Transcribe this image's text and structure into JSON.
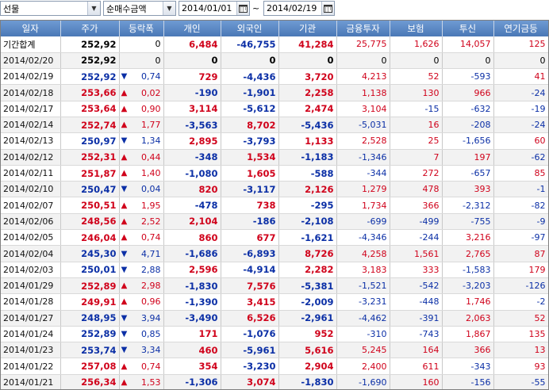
{
  "toolbar": {
    "market_select": "선물",
    "type_select": "순매수금액",
    "date_from": "2014/01/01",
    "date_sep": "~",
    "date_to": "2014/02/19"
  },
  "columns": [
    "일자",
    "주가",
    "등락폭",
    "개인",
    "외국인",
    "기관",
    "금융투자",
    "보험",
    "투신",
    "연기금등"
  ],
  "colors": {
    "up": "#d0021b",
    "down": "#0b2fa6",
    "header": "#4f81bd"
  },
  "summary": {
    "label": "기간합계",
    "price": "252,92",
    "change": "0",
    "individual": "6,484",
    "foreign": "-46,755",
    "institution": "41,284",
    "fin_invest": "25,775",
    "insurance": "1,626",
    "trust": "14,057",
    "pension": "125"
  },
  "rows": [
    {
      "date": "2014/02/20",
      "price": "252,92",
      "dir": "",
      "change": "0",
      "individual": "0",
      "foreign": "0",
      "institution": "0",
      "fin_invest": "0",
      "insurance": "0",
      "trust": "0",
      "pension": "0"
    },
    {
      "date": "2014/02/19",
      "price": "252,92",
      "dir": "down",
      "change": "0,74",
      "individual": "729",
      "foreign": "-4,436",
      "institution": "3,720",
      "fin_invest": "4,213",
      "insurance": "52",
      "trust": "-593",
      "pension": "41"
    },
    {
      "date": "2014/02/18",
      "price": "253,66",
      "dir": "up",
      "change": "0,02",
      "individual": "-190",
      "foreign": "-1,901",
      "institution": "2,258",
      "fin_invest": "1,138",
      "insurance": "130",
      "trust": "966",
      "pension": "-24"
    },
    {
      "date": "2014/02/17",
      "price": "253,64",
      "dir": "up",
      "change": "0,90",
      "individual": "3,114",
      "foreign": "-5,612",
      "institution": "2,474",
      "fin_invest": "3,104",
      "insurance": "-15",
      "trust": "-632",
      "pension": "-19"
    },
    {
      "date": "2014/02/14",
      "price": "252,74",
      "dir": "up",
      "change": "1,77",
      "individual": "-3,563",
      "foreign": "8,702",
      "institution": "-5,436",
      "fin_invest": "-5,031",
      "insurance": "16",
      "trust": "-208",
      "pension": "-24"
    },
    {
      "date": "2014/02/13",
      "price": "250,97",
      "dir": "down",
      "change": "1,34",
      "individual": "2,895",
      "foreign": "-3,793",
      "institution": "1,133",
      "fin_invest": "2,528",
      "insurance": "25",
      "trust": "-1,656",
      "pension": "60"
    },
    {
      "date": "2014/02/12",
      "price": "252,31",
      "dir": "up",
      "change": "0,44",
      "individual": "-348",
      "foreign": "1,534",
      "institution": "-1,183",
      "fin_invest": "-1,346",
      "insurance": "7",
      "trust": "197",
      "pension": "-62"
    },
    {
      "date": "2014/02/11",
      "price": "251,87",
      "dir": "up",
      "change": "1,40",
      "individual": "-1,080",
      "foreign": "1,605",
      "institution": "-588",
      "fin_invest": "-344",
      "insurance": "272",
      "trust": "-657",
      "pension": "85"
    },
    {
      "date": "2014/02/10",
      "price": "250,47",
      "dir": "down",
      "change": "0,04",
      "individual": "820",
      "foreign": "-3,117",
      "institution": "2,126",
      "fin_invest": "1,279",
      "insurance": "478",
      "trust": "393",
      "pension": "-1"
    },
    {
      "date": "2014/02/07",
      "price": "250,51",
      "dir": "up",
      "change": "1,95",
      "individual": "-478",
      "foreign": "738",
      "institution": "-295",
      "fin_invest": "1,734",
      "insurance": "366",
      "trust": "-2,312",
      "pension": "-82"
    },
    {
      "date": "2014/02/06",
      "price": "248,56",
      "dir": "up",
      "change": "2,52",
      "individual": "2,104",
      "foreign": "-186",
      "institution": "-2,108",
      "fin_invest": "-699",
      "insurance": "-499",
      "trust": "-755",
      "pension": "-9"
    },
    {
      "date": "2014/02/05",
      "price": "246,04",
      "dir": "up",
      "change": "0,74",
      "individual": "860",
      "foreign": "677",
      "institution": "-1,621",
      "fin_invest": "-4,346",
      "insurance": "-244",
      "trust": "3,216",
      "pension": "-97"
    },
    {
      "date": "2014/02/04",
      "price": "245,30",
      "dir": "down",
      "change": "4,71",
      "individual": "-1,686",
      "foreign": "-6,893",
      "institution": "8,726",
      "fin_invest": "4,258",
      "insurance": "1,561",
      "trust": "2,765",
      "pension": "87"
    },
    {
      "date": "2014/02/03",
      "price": "250,01",
      "dir": "down",
      "change": "2,88",
      "individual": "2,596",
      "foreign": "-4,914",
      "institution": "2,282",
      "fin_invest": "3,183",
      "insurance": "333",
      "trust": "-1,583",
      "pension": "179"
    },
    {
      "date": "2014/01/29",
      "price": "252,89",
      "dir": "up",
      "change": "2,98",
      "individual": "-1,830",
      "foreign": "7,576",
      "institution": "-5,381",
      "fin_invest": "-1,521",
      "insurance": "-542",
      "trust": "-3,203",
      "pension": "-126"
    },
    {
      "date": "2014/01/28",
      "price": "249,91",
      "dir": "up",
      "change": "0,96",
      "individual": "-1,390",
      "foreign": "3,415",
      "institution": "-2,009",
      "fin_invest": "-3,231",
      "insurance": "-448",
      "trust": "1,746",
      "pension": "-2"
    },
    {
      "date": "2014/01/27",
      "price": "248,95",
      "dir": "down",
      "change": "3,94",
      "individual": "-3,490",
      "foreign": "6,526",
      "institution": "-2,961",
      "fin_invest": "-4,462",
      "insurance": "-391",
      "trust": "2,063",
      "pension": "52"
    },
    {
      "date": "2014/01/24",
      "price": "252,89",
      "dir": "down",
      "change": "0,85",
      "individual": "171",
      "foreign": "-1,076",
      "institution": "952",
      "fin_invest": "-310",
      "insurance": "-743",
      "trust": "1,867",
      "pension": "135"
    },
    {
      "date": "2014/01/23",
      "price": "253,74",
      "dir": "down",
      "change": "3,34",
      "individual": "460",
      "foreign": "-5,961",
      "institution": "5,616",
      "fin_invest": "5,245",
      "insurance": "164",
      "trust": "366",
      "pension": "13"
    },
    {
      "date": "2014/01/22",
      "price": "257,08",
      "dir": "up",
      "change": "0,74",
      "individual": "354",
      "foreign": "-3,230",
      "institution": "2,904",
      "fin_invest": "2,400",
      "insurance": "611",
      "trust": "-343",
      "pension": "93"
    },
    {
      "date": "2014/01/21",
      "price": "256,34",
      "dir": "up",
      "change": "1,53",
      "individual": "-1,306",
      "foreign": "3,074",
      "institution": "-1,830",
      "fin_invest": "-1,690",
      "insurance": "160",
      "trust": "-156",
      "pension": "-55"
    }
  ]
}
